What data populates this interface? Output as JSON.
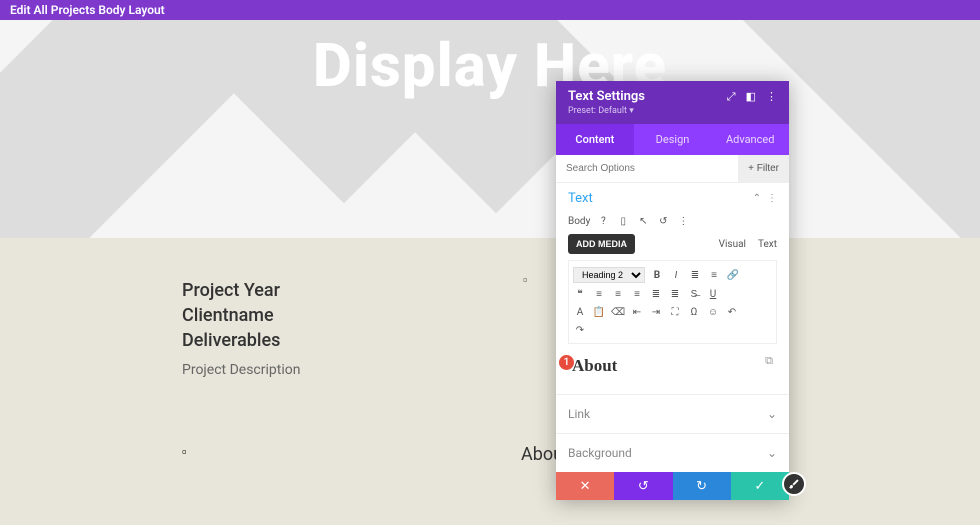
{
  "topbar": {
    "title": "Edit All Projects Body Layout"
  },
  "hero": {
    "title": "Display Here"
  },
  "meta": {
    "line1": "Project Year",
    "line2": "Clientname",
    "line3": "Deliverables",
    "desc": "Project Description"
  },
  "page_about": "About",
  "panel": {
    "title": "Text Settings",
    "preset": "Preset: Default ▾",
    "tabs": {
      "content": "Content",
      "design": "Design",
      "advanced": "Advanced"
    },
    "search_placeholder": "Search Options",
    "filter": "+  Filter",
    "text_section": "Text",
    "body_label": "Body",
    "add_media": "ADD MEDIA",
    "visual": "Visual",
    "text_tab": "Text",
    "heading_sel": "Heading 2",
    "editor_heading": "About",
    "marker": "1",
    "link": "Link",
    "background": "Background"
  }
}
